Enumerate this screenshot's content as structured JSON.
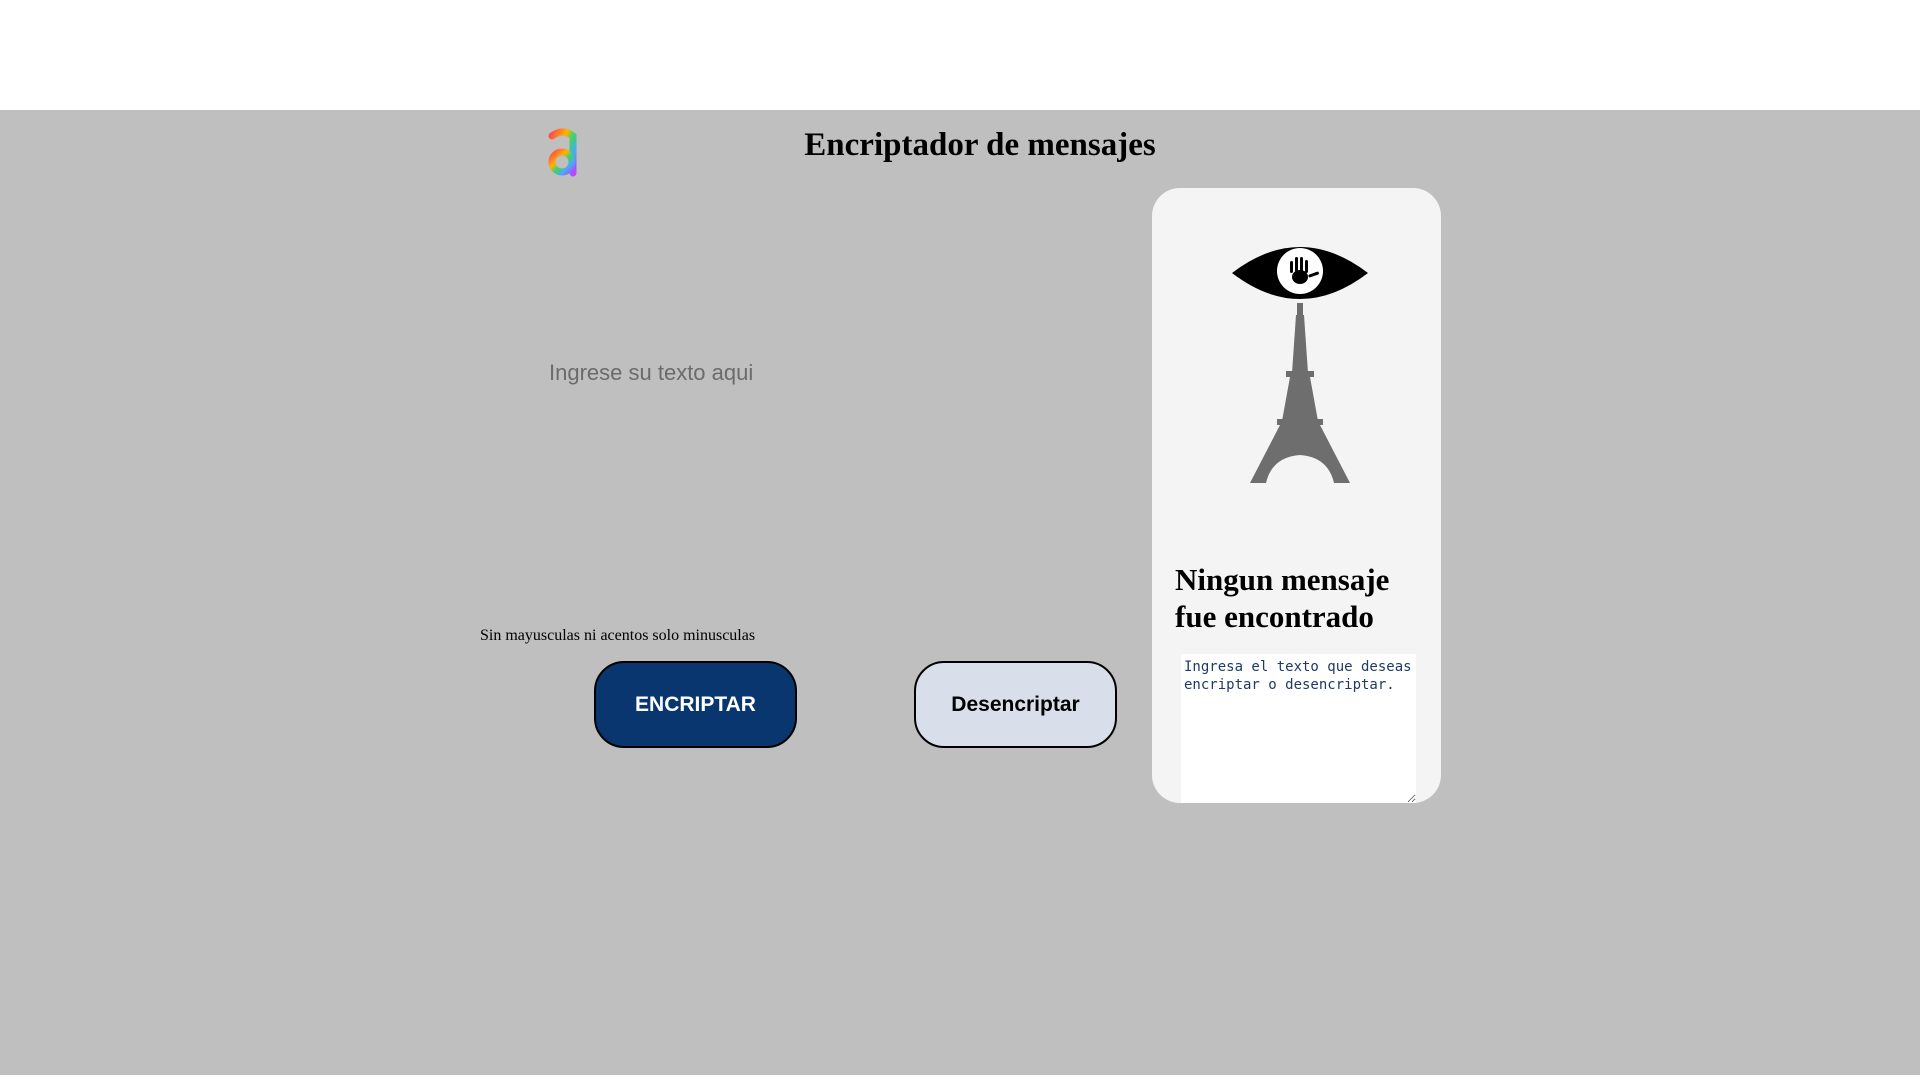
{
  "header": {
    "title": "Encriptador de mensajes",
    "logo_icon": "alura-a-logo-icon"
  },
  "input": {
    "placeholder": "Ingrese su texto aqui",
    "value": ""
  },
  "hint": "Sin mayusculas ni acentos solo minusculas",
  "buttons": {
    "encrypt_label": "ENCRIPTAR",
    "decrypt_label": "Desencriptar"
  },
  "panel": {
    "illustration_icon": "eye-eiffel-tower-icon",
    "title": "Ningun mensaje fue encontrado",
    "output_text": "Ingresa el texto que deseas encriptar o desencriptar."
  },
  "colors": {
    "page_background": "#bfbfbf",
    "panel_background": "#f4f4f4",
    "encrypt_button": "#0a3670",
    "decrypt_button": "#d8dfeb"
  }
}
